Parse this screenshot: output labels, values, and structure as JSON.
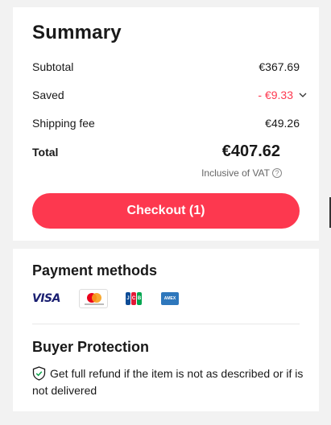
{
  "summary": {
    "title": "Summary",
    "subtotal_label": "Subtotal",
    "subtotal_value": "€367.69",
    "saved_label": "Saved",
    "saved_value": "- €9.33",
    "shipping_label": "Shipping fee",
    "shipping_value": "€49.26",
    "total_label": "Total",
    "total_value": "€407.62",
    "vat_note": "Inclusive of VAT",
    "checkout_label": "Checkout (1)"
  },
  "payment": {
    "title": "Payment methods",
    "methods": [
      {
        "name": "VISA",
        "icon": "visa-icon"
      },
      {
        "name": "mastercard",
        "icon": "mastercard-icon"
      },
      {
        "name": "JCB",
        "icon": "jcb-icon"
      },
      {
        "name": "AMERICAN EXPRESS",
        "icon": "amex-icon"
      }
    ]
  },
  "buyer_protection": {
    "title": "Buyer Protection",
    "text": "Get full refund if the item is not as described or if is not delivered",
    "icon": "shield-check-icon"
  },
  "colors": {
    "accent": "#fd384f",
    "background": "#f2f2f2",
    "card": "#ffffff",
    "text": "#191919",
    "muted": "#666666"
  }
}
